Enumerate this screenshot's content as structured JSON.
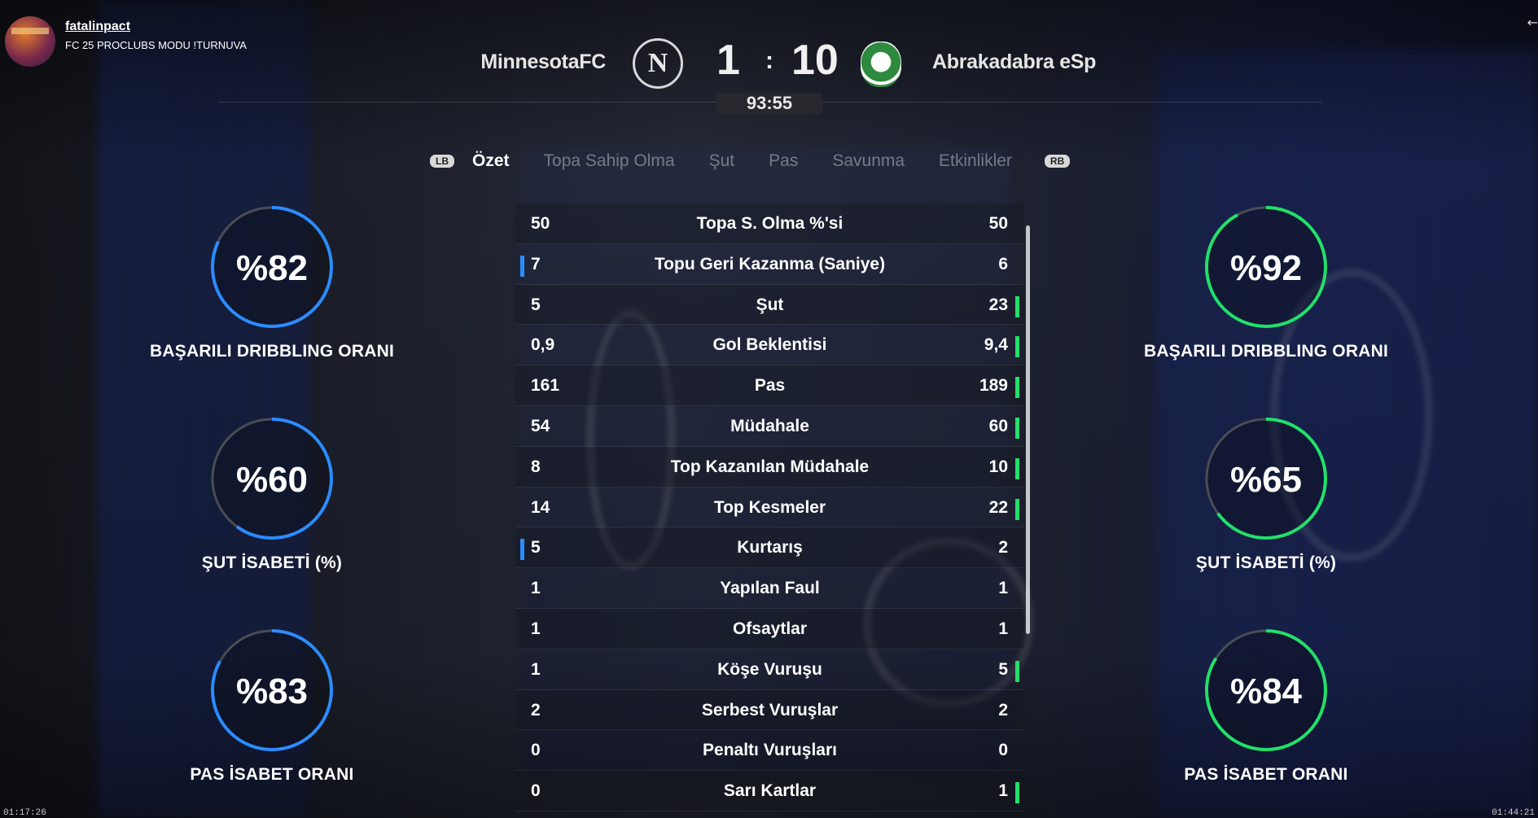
{
  "channel": {
    "name": "fatalinpact",
    "subtitle": "FC 25 PROCLUBS MODU !TURNUVA"
  },
  "match": {
    "home_team": "MinnesotaFC",
    "home_badge_letter": "N",
    "home_score": "1",
    "separator": ":",
    "away_score": "10",
    "away_team": "Abrakadabra eSp",
    "clock": "93:55"
  },
  "tabs": {
    "lb": "LB",
    "rb": "RB",
    "items": [
      "Özet",
      "Topa Sahip Olma",
      "Şut",
      "Pas",
      "Savunma",
      "Etkinlikler"
    ],
    "active": "Özet"
  },
  "stats": [
    {
      "home": "50",
      "label": "Topa S. Olma %'si",
      "away": "50",
      "lead": "none"
    },
    {
      "home": "7",
      "label": "Topu Geri Kazanma (Saniye)",
      "away": "6",
      "lead": "home"
    },
    {
      "home": "5",
      "label": "Şut",
      "away": "23",
      "lead": "away"
    },
    {
      "home": "0,9",
      "label": "Gol Beklentisi",
      "away": "9,4",
      "lead": "away"
    },
    {
      "home": "161",
      "label": "Pas",
      "away": "189",
      "lead": "away"
    },
    {
      "home": "54",
      "label": "Müdahale",
      "away": "60",
      "lead": "away"
    },
    {
      "home": "8",
      "label": "Top Kazanılan Müdahale",
      "away": "10",
      "lead": "away"
    },
    {
      "home": "14",
      "label": "Top Kesmeler",
      "away": "22",
      "lead": "away"
    },
    {
      "home": "5",
      "label": "Kurtarış",
      "away": "2",
      "lead": "home"
    },
    {
      "home": "1",
      "label": "Yapılan Faul",
      "away": "1",
      "lead": "none"
    },
    {
      "home": "1",
      "label": "Ofsaytlar",
      "away": "1",
      "lead": "none"
    },
    {
      "home": "1",
      "label": "Köşe Vuruşu",
      "away": "5",
      "lead": "away"
    },
    {
      "home": "2",
      "label": "Serbest Vuruşlar",
      "away": "2",
      "lead": "none"
    },
    {
      "home": "0",
      "label": "Penaltı Vuruşları",
      "away": "0",
      "lead": "none"
    },
    {
      "home": "0",
      "label": "Sarı Kartlar",
      "away": "1",
      "lead": "away"
    }
  ],
  "rings": {
    "home": [
      {
        "text": "%82",
        "value": 82,
        "label": "BAŞARILI DRIBBLING ORANI"
      },
      {
        "text": "%60",
        "value": 60,
        "label": "ŞUT İSABETİ (%)"
      },
      {
        "text": "%83",
        "value": 83,
        "label": "PAS İSABET ORANI"
      }
    ],
    "away": [
      {
        "text": "%92",
        "value": 92,
        "label": "BAŞARILI DRIBBLING ORANI"
      },
      {
        "text": "%65",
        "value": 65,
        "label": "ŞUT İSABETİ (%)"
      },
      {
        "text": "%84",
        "value": 84,
        "label": "PAS İSABET ORANI"
      }
    ]
  },
  "colors": {
    "home": "#2b8cff",
    "away": "#22e06a",
    "track": "#4a4d55"
  },
  "timestamps": {
    "left": "01:17:26",
    "right": "01:44:21"
  }
}
